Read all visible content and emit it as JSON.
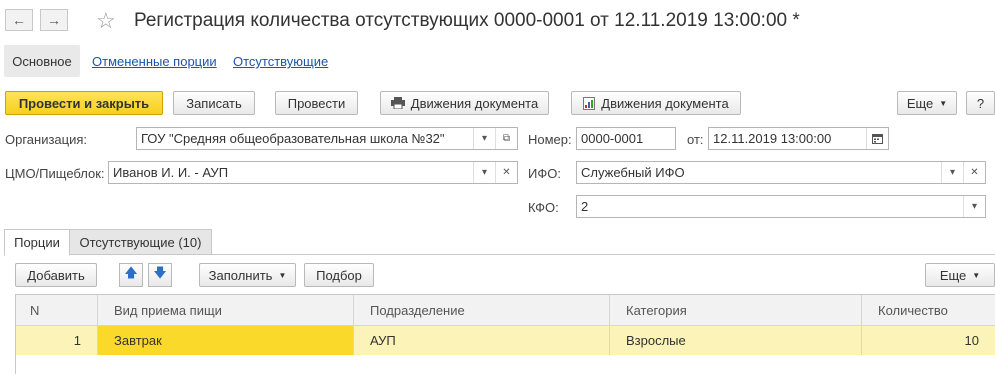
{
  "window": {
    "title": "Регистрация количества отсутствующих 0000-0001 от 12.11.2019 13:00:00 *",
    "back_glyph": "←",
    "forward_glyph": "→",
    "star_glyph": "☆"
  },
  "subnav": {
    "active": "Основное",
    "links": [
      "Отмененные порции",
      "Отсутствующие"
    ]
  },
  "toolbar": {
    "post_close": "Провести и закрыть",
    "save": "Записать",
    "post": "Провести",
    "movements1": "Движения документа",
    "movements2": "Движения документа",
    "more": "Еще",
    "help": "?"
  },
  "form": {
    "org_label": "Организация:",
    "org_value": "ГОУ \"Средняя общеобразовательная школа №32\"",
    "number_label": "Номер:",
    "number_value": "0000-0001",
    "date_label": "от:",
    "date_value": "12.11.2019 13:00:00",
    "cmo_label": "ЦМО/Пищеблок:",
    "cmo_value": "Иванов И. И. - АУП",
    "ifo_label": "ИФО:",
    "ifo_value": "Служебный ИФО",
    "kfo_label": "КФО:",
    "kfo_value": "2"
  },
  "tabs": [
    {
      "label": "Порции",
      "active": true
    },
    {
      "label": "Отсутствующие (10)",
      "active": false
    }
  ],
  "table_toolbar": {
    "add": "Добавить",
    "up_glyph": "🡅",
    "down_glyph": "🡇",
    "fill": "Заполнить",
    "select": "Подбор",
    "more": "Еще"
  },
  "table": {
    "columns": [
      "N",
      "Вид приема пищи",
      "Подразделение",
      "Категория",
      "Количество"
    ],
    "rows": [
      {
        "n": "1",
        "meal": "Завтрак",
        "dept": "АУП",
        "category": "Взрослые",
        "qty": "10"
      }
    ]
  },
  "colors": {
    "accent": "#f7cf1c",
    "link": "#1a56a8",
    "row_highlight": "#fbf3b7",
    "cell_selected": "#fbd92a"
  }
}
